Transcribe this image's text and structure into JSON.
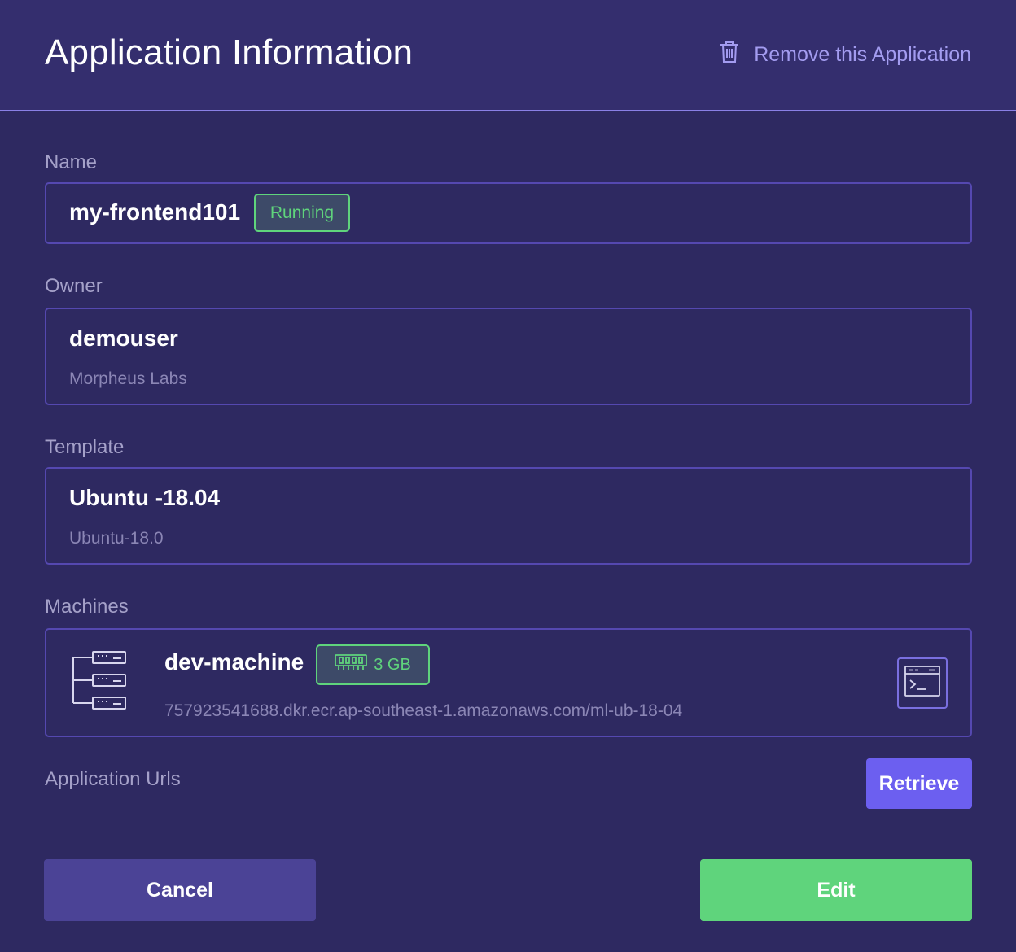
{
  "header": {
    "title": "Application Information",
    "remove_label": "Remove this Application",
    "remove_icon": "trash-icon"
  },
  "name_field": {
    "label": "Name",
    "value": "my-frontend101",
    "status": "Running"
  },
  "owner_field": {
    "label": "Owner",
    "username": "demouser",
    "organization": "Morpheus Labs"
  },
  "template_field": {
    "label": "Template",
    "name": "Ubuntu -18.04",
    "image": "Ubuntu-18.0"
  },
  "machines_field": {
    "label": "Machines",
    "machine": {
      "name": "dev-machine",
      "memory": "3 GB",
      "image_uri": "757923541688.dkr.ecr.ap-southeast-1.amazonaws.com/ml-ub-18-04",
      "icon": "server-stack-icon",
      "memory_icon": "memory-chip-icon",
      "terminal_icon": "terminal-icon"
    }
  },
  "urls_field": {
    "label": "Application Urls",
    "retrieve_label": "Retrieve"
  },
  "actions": {
    "cancel_label": "Cancel",
    "edit_label": "Edit"
  },
  "colors": {
    "background": "#2e2961",
    "header_bg": "#342e6e",
    "accent": "#6c5ff0",
    "success": "#5fd47c",
    "border": "#5548b0"
  }
}
